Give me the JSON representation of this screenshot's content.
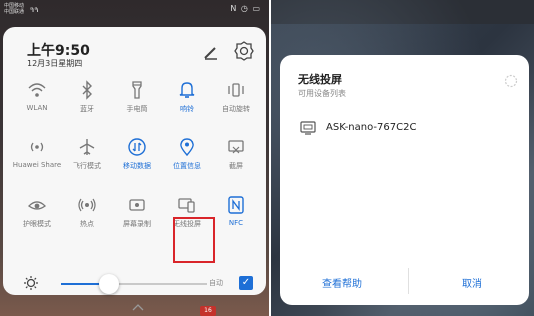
{
  "left_screen": {
    "status_bar": {
      "carrier_lines": [
        "中国移动",
        "中国联通"
      ],
      "signal": "ᵃᵢₗ ᵃᵢₗ",
      "right_icons": "N ◷ ▭"
    },
    "quick_settings": {
      "time": "上午9:50",
      "date": "12月3日星期四",
      "tiles": [
        {
          "label": "WLAN",
          "icon": "wifi-icon",
          "active": false
        },
        {
          "label": "蓝牙",
          "icon": "bluetooth-icon",
          "active": false
        },
        {
          "label": "手电筒",
          "icon": "flashlight-icon",
          "active": false
        },
        {
          "label": "响铃",
          "icon": "bell-icon",
          "active": true
        },
        {
          "label": "自动旋转",
          "icon": "rotate-icon",
          "active": false
        },
        {
          "label": "Huawei Share",
          "icon": "huawei-share-icon",
          "active": false
        },
        {
          "label": "飞行模式",
          "icon": "airplane-icon",
          "active": false
        },
        {
          "label": "移动数据",
          "icon": "mobile-data-icon",
          "active": true
        },
        {
          "label": "位置信息",
          "icon": "location-icon",
          "active": true
        },
        {
          "label": "截屏",
          "icon": "screenshot-icon",
          "active": false
        },
        {
          "label": "护眼模式",
          "icon": "eye-comfort-icon",
          "active": false
        },
        {
          "label": "热点",
          "icon": "hotspot-icon",
          "active": false
        },
        {
          "label": "屏幕录制",
          "icon": "screen-record-icon",
          "active": false
        },
        {
          "label": "无线投屏",
          "icon": "wireless-projection-icon",
          "active": false
        },
        {
          "label": "NFC",
          "icon": "nfc-icon",
          "active": true
        }
      ],
      "brightness_value": 0.35,
      "auto_label": "自动",
      "auto_checked": true
    },
    "badge_text": "16"
  },
  "right_screen": {
    "dialog": {
      "title": "无线投屏",
      "subtitle": "可用设备列表",
      "devices": [
        {
          "name": "ASK-nano-767C2C",
          "icon": "tv-icon"
        }
      ],
      "help_button": "查看帮助",
      "cancel_button": "取消"
    }
  },
  "colors": {
    "accent": "#1e6fd6",
    "highlight_box": "#d9252a"
  }
}
